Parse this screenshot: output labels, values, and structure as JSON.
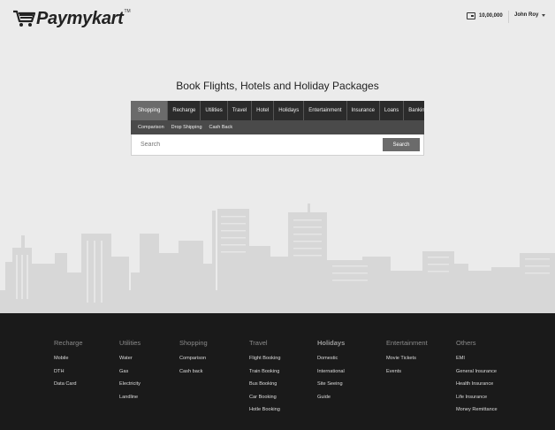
{
  "header": {
    "logo_text": "Paymykart",
    "logo_tm": "TM",
    "wallet_balance": "10,00,000",
    "user_name": "John Roy",
    "wallet_icon": "wallet-icon",
    "user_menu_icon": "chevron-down-icon"
  },
  "headline": "Book Flights, Hotels and Holiday Packages",
  "tabs": [
    {
      "label": "Shopping",
      "active": true
    },
    {
      "label": "Recharge"
    },
    {
      "label": "Utilities"
    },
    {
      "label": "Travel"
    },
    {
      "label": "Hotel"
    },
    {
      "label": "Holidays"
    },
    {
      "label": "Entertainment"
    },
    {
      "label": "Insurance"
    },
    {
      "label": "Loans"
    },
    {
      "label": "Banking"
    }
  ],
  "subtabs": [
    "Comparison",
    "Drop Shipping",
    "Cash Back"
  ],
  "search": {
    "placeholder": "Search",
    "button_label": "Search"
  },
  "footer": {
    "columns": [
      {
        "title": "Recharge",
        "items": [
          "Mobile",
          "DTH",
          "Data Card"
        ]
      },
      {
        "title": "Utilities",
        "items": [
          "Water",
          "Gas",
          "Electricity",
          "Landline"
        ]
      },
      {
        "title": "Shopping",
        "items": [
          "Comparison",
          "Cash back"
        ]
      },
      {
        "title": "Travel",
        "items": [
          "Flight Booking",
          "Train Booking",
          "Bus Booking",
          "Car Booking",
          "Hotle Booking"
        ]
      },
      {
        "title": "Holidays",
        "items": [
          "Domestic",
          "International",
          "Site Seeing",
          "Guide"
        ]
      },
      {
        "title": "Entertainment",
        "items": [
          "Movie Tickets",
          "Events"
        ]
      },
      {
        "title": "Others",
        "items": [
          "EMI",
          "General Insurance",
          "Health Insurance",
          "Life Insurance",
          "Money Remittance"
        ]
      }
    ]
  },
  "colors": {
    "background": "#ebebeb",
    "tab_bar": "#2b2b2b",
    "tab_active": "#6b6b6b",
    "subtab_bar": "#4a4a4a",
    "footer": "#1a1a1a"
  }
}
